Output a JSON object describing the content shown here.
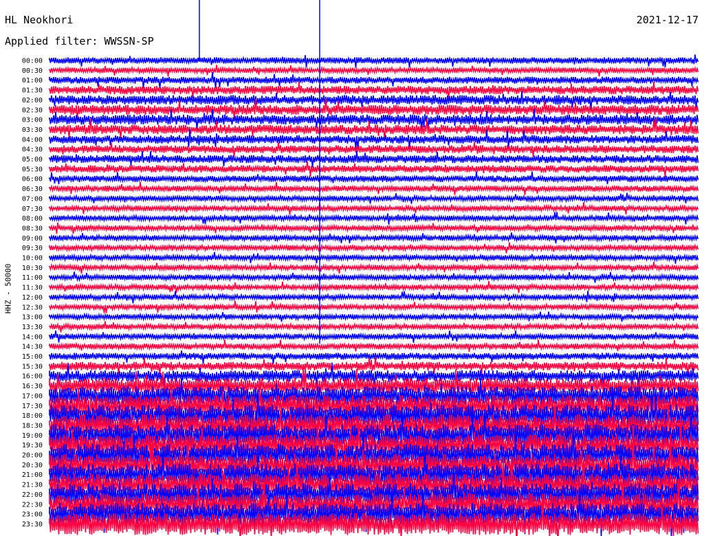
{
  "header": {
    "station": "HL Neokhori",
    "date": "2021-12-17",
    "filter": "Applied filter: WWSSN-SP"
  },
  "chart_data": {
    "type": "line",
    "title": "HL Neokhori",
    "subtitle": "Applied filter: WWSSN-SP",
    "ylabel": "HHZ - 50000",
    "xlabel": "",
    "row_labels": [
      "00:00",
      "00:30",
      "01:00",
      "01:30",
      "02:00",
      "02:30",
      "03:00",
      "03:30",
      "04:00",
      "04:30",
      "05:00",
      "05:30",
      "06:00",
      "06:30",
      "07:00",
      "07:30",
      "08:00",
      "08:30",
      "09:00",
      "09:30",
      "10:00",
      "10:30",
      "11:00",
      "11:30",
      "12:00",
      "12:30",
      "13:00",
      "13:30",
      "14:00",
      "14:30",
      "15:00",
      "15:30",
      "16:00",
      "16:30",
      "17:00",
      "17:30",
      "18:00",
      "18:30",
      "19:00",
      "19:30",
      "20:00",
      "20:30",
      "21:00",
      "21:30",
      "22:00",
      "22:30",
      "23:00",
      "23:30"
    ],
    "series_colors": [
      "#0000ff",
      "#ff0040"
    ],
    "row_amplitude": [
      1.2,
      1,
      1.3,
      1.6,
      1.8,
      1.9,
      1.9,
      1.8,
      1.6,
      1.5,
      1.5,
      1.4,
      1.2,
      1.1,
      1,
      1,
      1,
      1,
      1,
      1,
      1,
      1,
      1,
      1,
      1,
      1,
      1,
      1,
      1.1,
      1.1,
      1.3,
      1.6,
      2.2,
      3,
      3.6,
      4,
      4.2,
      4.2,
      4.2,
      4.2,
      4.2,
      4.2,
      4.2,
      4.2,
      4.2,
      4.2,
      4.2,
      4.2
    ],
    "grid": false
  }
}
